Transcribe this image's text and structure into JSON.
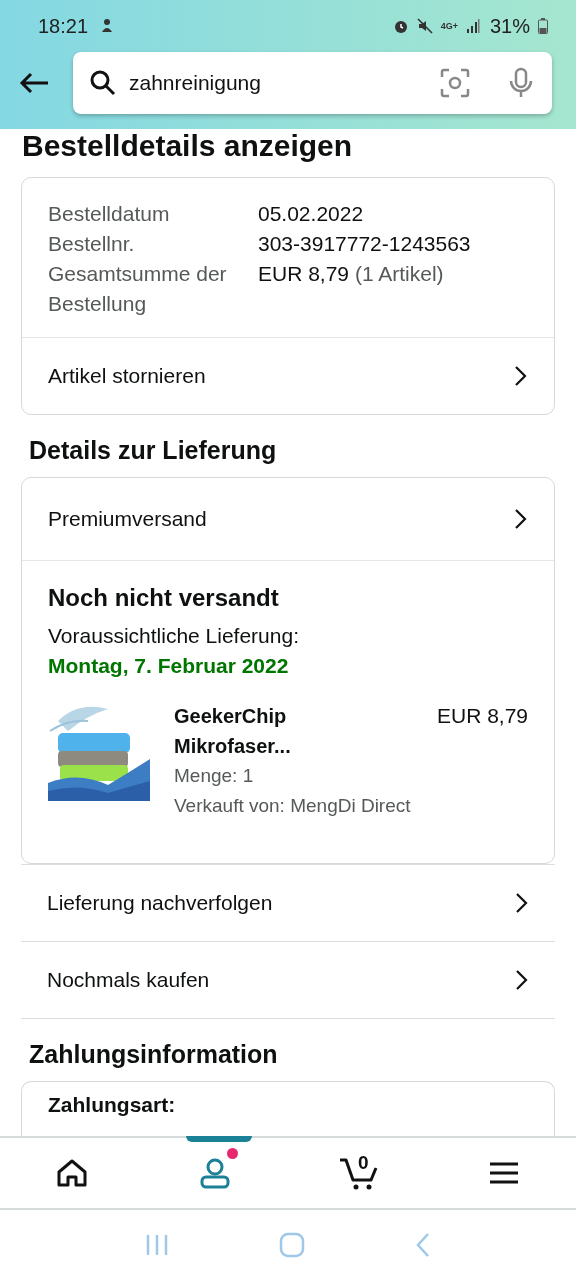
{
  "status_bar": {
    "time": "18:21",
    "network": "4G+",
    "battery": "31%"
  },
  "search": {
    "value": "zahnreinigung"
  },
  "page_title": "Bestelldetails anzeigen",
  "order_summary": {
    "rows": [
      {
        "label": "Bestelldatum",
        "value": "05.02.2022"
      },
      {
        "label": "Bestellnr.",
        "value": "303-3917772-1243563"
      },
      {
        "label": "Gesamtsumme der Bestellung",
        "value": "EUR 8,79",
        "note": "(1 Artikel)"
      }
    ],
    "action": "Artikel stornieren"
  },
  "delivery": {
    "heading": "Details zur Lieferung",
    "shipping_method": "Premiumversand",
    "status": "Noch nicht versandt",
    "eta_label": "Voraussichtliche Lieferung:",
    "eta_date": "Montag, 7. Februar 2022",
    "item": {
      "kind": "picture",
      "title": "GeekerChip Mikrofaser...",
      "price": "EUR 8,79",
      "quantity": "Menge: 1",
      "seller": "Verkauft von: MengDi Direct"
    }
  },
  "actions": [
    "Lieferung nachverfolgen",
    "Nochmals kaufen"
  ],
  "payment": {
    "heading": "Zahlungsinformation",
    "label": "Zahlungsart:"
  },
  "bottom_nav": [
    {
      "kind": "home",
      "selected": false
    },
    {
      "kind": "account",
      "selected": true,
      "badge": true
    },
    {
      "kind": "cart",
      "selected": false,
      "count": "0"
    },
    {
      "kind": "menu",
      "selected": false
    }
  ]
}
